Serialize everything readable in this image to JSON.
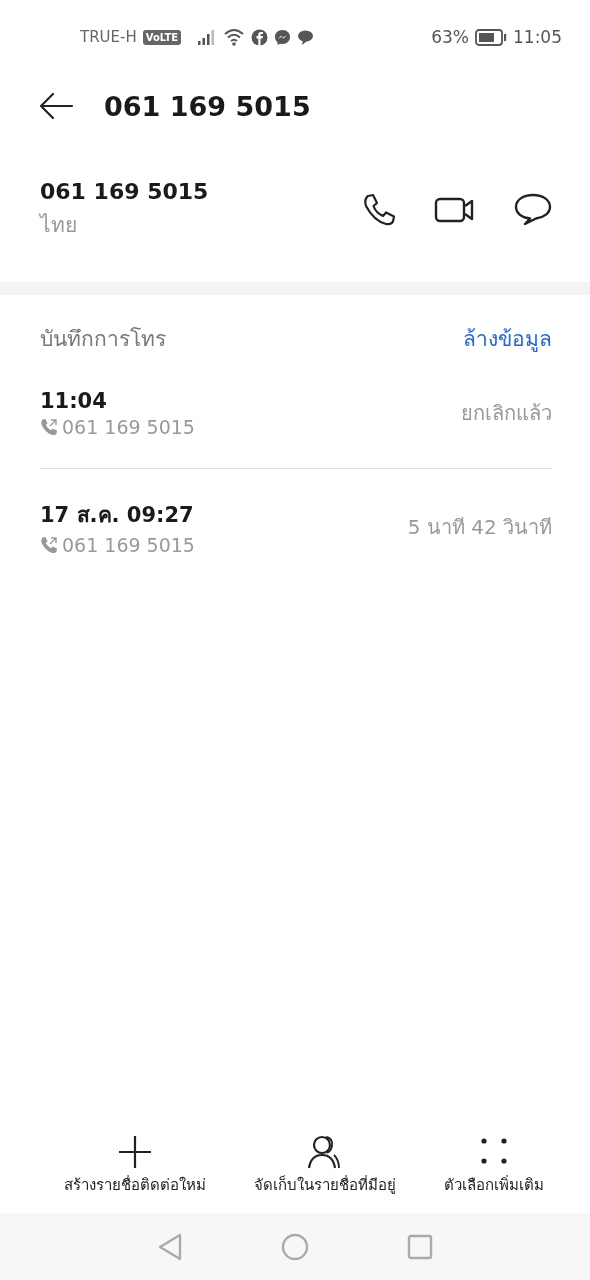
{
  "status_bar": {
    "carrier": "TRUE-H",
    "network_badge": "VoLTE",
    "battery_percent": "63%",
    "time": "11:05"
  },
  "header": {
    "title": "061 169 5015"
  },
  "contact": {
    "number": "061 169 5015",
    "location": "ไทย"
  },
  "call_log": {
    "title": "บันทึกการโทร",
    "clear_link": "ล้างข้อมูล",
    "entries": [
      {
        "time": "11:04",
        "number": "061 169 5015",
        "result": "ยกเลิกแล้ว"
      },
      {
        "time": "17 ส.ค. 09:27",
        "number": "061 169 5015",
        "result": "5 นาที 42 วินาที"
      }
    ]
  },
  "actions": [
    {
      "kind": "add",
      "label": "สร้างรายชื่อติดต่อใหม่"
    },
    {
      "kind": "contact",
      "label": "จัดเก็บในรายชื่อที่มีอยู่"
    },
    {
      "kind": "more",
      "label": "ตัวเลือกเพิ่มเติม"
    }
  ]
}
